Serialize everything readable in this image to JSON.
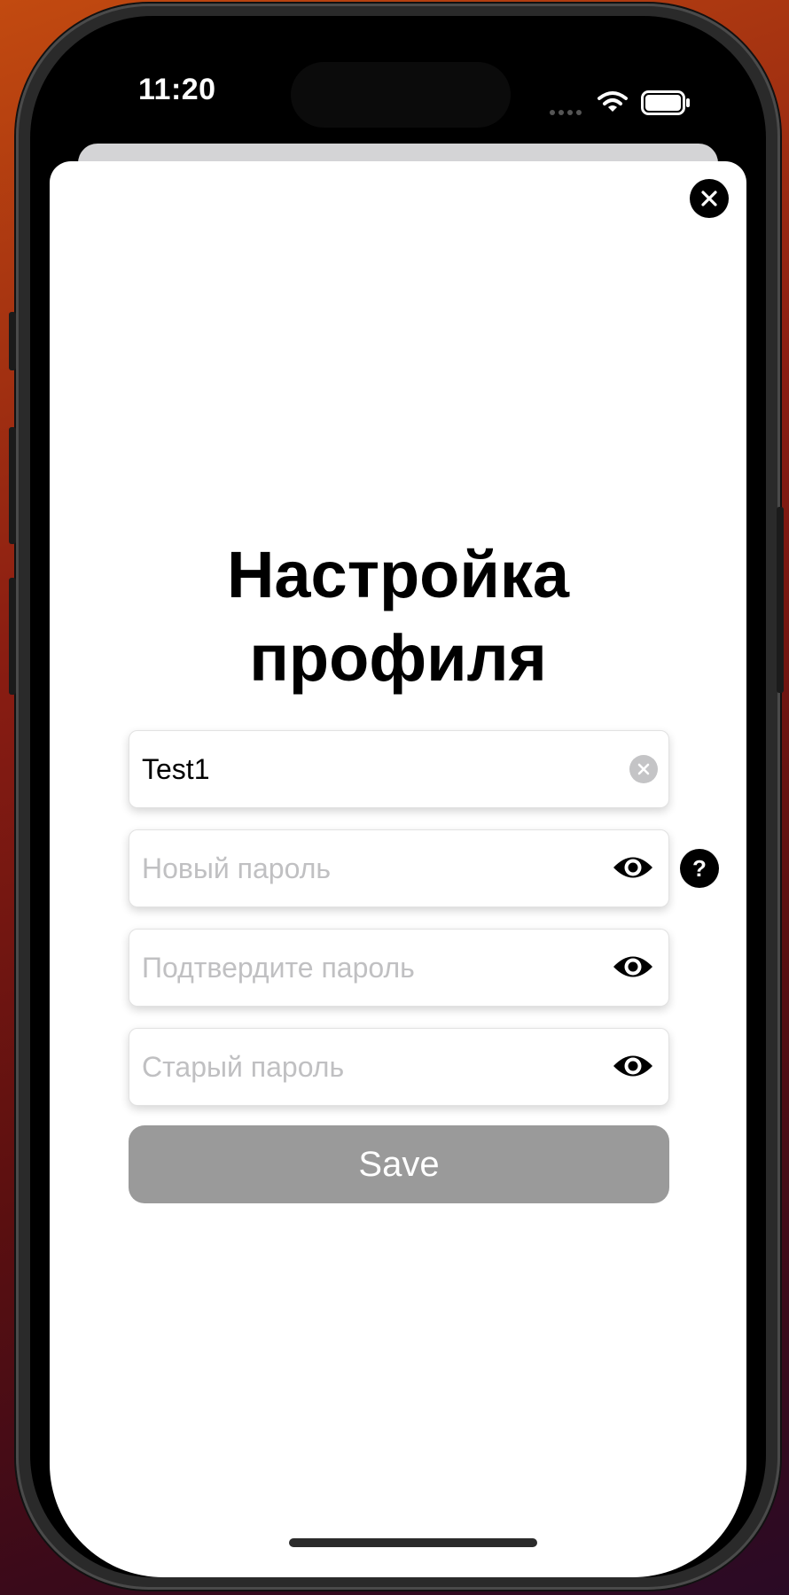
{
  "status_bar": {
    "time": "11:20"
  },
  "profile_settings": {
    "title_line1": "Настройка",
    "title_line2": "профиля",
    "username_value": "Test1",
    "new_password_placeholder": "Новый пароль",
    "confirm_password_placeholder": "Подтвердите пароль",
    "old_password_placeholder": "Старый пароль",
    "help_label": "?",
    "save_label": "Save"
  },
  "icons": {
    "close": "close-icon",
    "clear": "clear-icon",
    "show_password": "eye-icon",
    "help": "question-icon",
    "wifi": "wifi-icon",
    "battery": "battery-icon"
  },
  "colors": {
    "save_button_bg": "#9a9a9a",
    "placeholder_text": "#c0c0c2",
    "accent_dark": "#000000"
  }
}
